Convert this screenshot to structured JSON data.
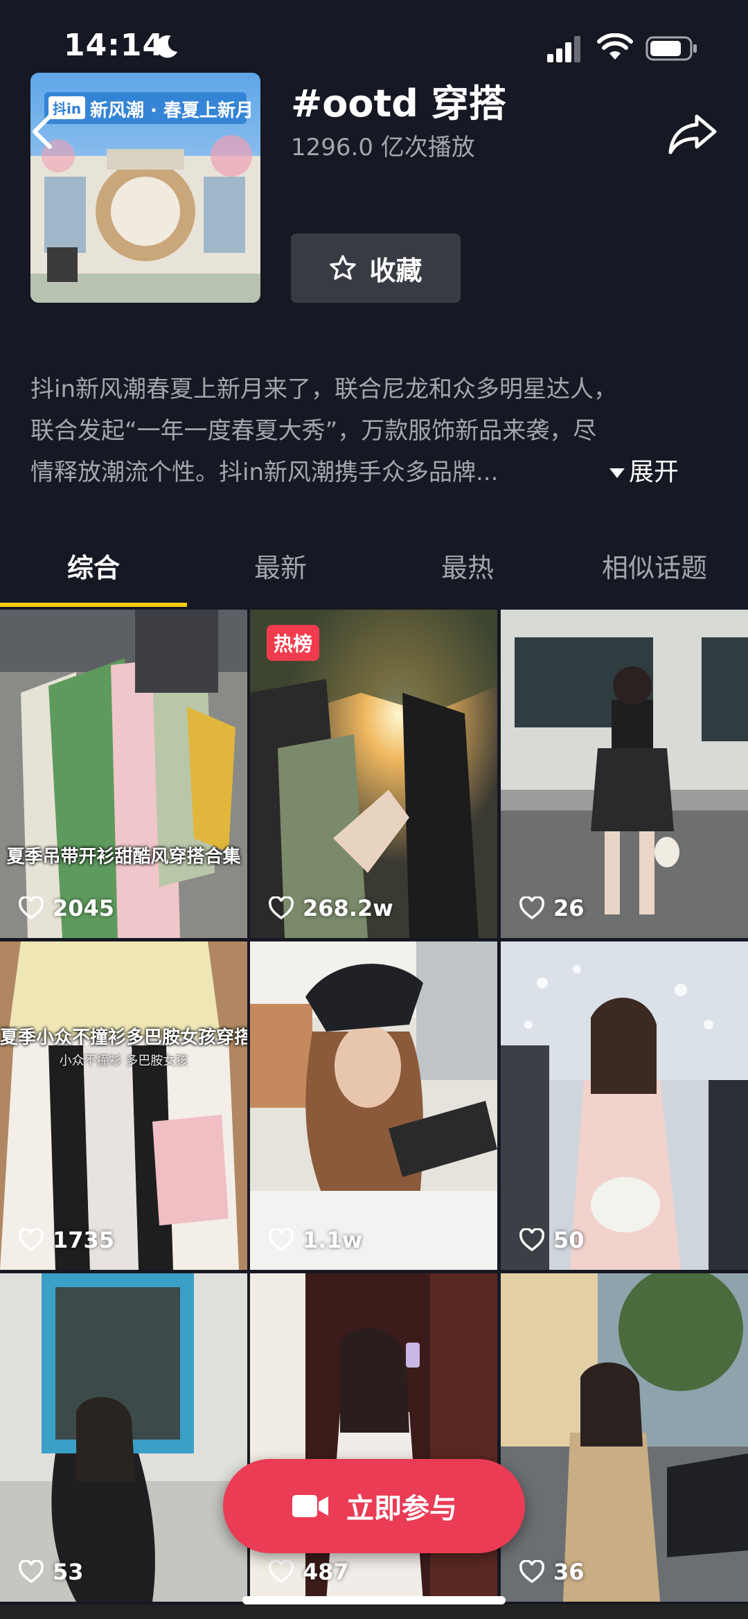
{
  "status_bar": {
    "time": "14:14"
  },
  "topic": {
    "title": "#ootd 穿搭",
    "plays": "1296.0 亿次播放",
    "cover_banner_text": "新风潮 · 春夏上新月",
    "cover_brand": "抖in",
    "favorite_label": "收藏"
  },
  "description": {
    "lines": [
      "抖in新风潮春夏上新月来了，联合尼龙和众多明星达人，",
      "联合发起“一年一度春夏大秀”，万款服饰新品来袭，尽",
      "情释放潮流个性。抖in新风潮携手众多品牌..."
    ],
    "expand_label": "展开"
  },
  "tabs": [
    {
      "label": "综合",
      "active": true
    },
    {
      "label": "最新",
      "active": false
    },
    {
      "label": "最热",
      "active": false
    },
    {
      "label": "相似话题",
      "active": false
    }
  ],
  "grid": [
    {
      "likes": "2045",
      "caption": "夏季吊带开衫甜酷风穿搭合集"
    },
    {
      "likes": "268.2w",
      "badge": "热榜"
    },
    {
      "likes": "26"
    },
    {
      "likes": "1735",
      "caption": "夏季小众不撞衫多巴胺女孩穿搭",
      "subcaption": "小众不撞衫 多巴胺女孩"
    },
    {
      "likes": "1.1w"
    },
    {
      "likes": "50"
    },
    {
      "likes": "53"
    },
    {
      "likes": "487"
    },
    {
      "likes": "36"
    }
  ],
  "join_button": {
    "label": "立即参与"
  },
  "colors": {
    "background": "#161823",
    "accent_underline": "#fecc11",
    "join_button": "#ea3c55",
    "hot_badge": "#f23c4e"
  }
}
